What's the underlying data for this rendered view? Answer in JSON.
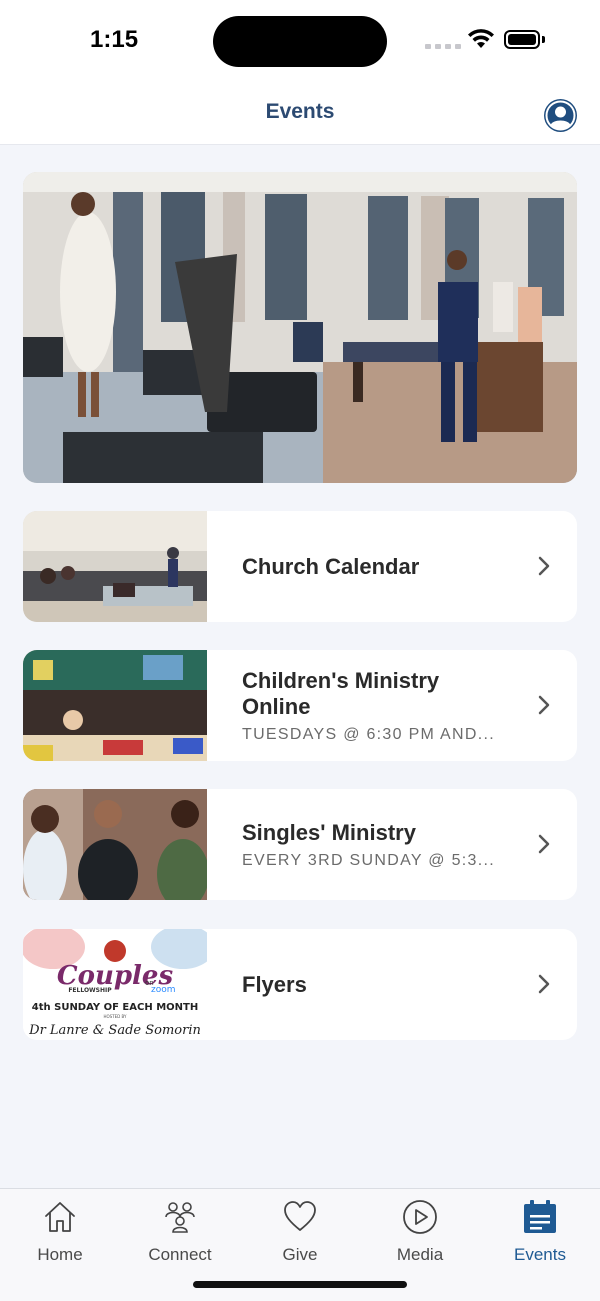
{
  "status_bar": {
    "time": "1:15"
  },
  "header": {
    "title": "Events",
    "profile_icon": "profile-icon"
  },
  "colors": {
    "accent": "#1f5a93",
    "title": "#2c4a72",
    "background": "#f3f5fa"
  },
  "hero": {
    "image": "worship-stage-photo"
  },
  "events": [
    {
      "title": "Church Calendar",
      "subtitle": "",
      "thumbnail": "congregation-photo"
    },
    {
      "title": "Children's Ministry Online",
      "subtitle": "TUESDAYS @ 6:30 PM AND...",
      "thumbnail": "children-classroom-photo"
    },
    {
      "title": "Singles' Ministry",
      "subtitle": "EVERY 3RD SUNDAY @ 5:3...",
      "thumbnail": "singles-group-photo"
    },
    {
      "title": "Flyers",
      "subtitle": "",
      "thumbnail": "couples-flyer",
      "flyer_text": {
        "headline": "Couples",
        "on": "on",
        "zoom": "zoom",
        "fellowship": "FELLOWSHIP",
        "schedule": "4th SUNDAY OF EACH MONTH",
        "hosted_by": "HOSTED BY",
        "hosts": "Dr Lanre & Sade Somorin"
      }
    }
  ],
  "tabbar": {
    "items": [
      {
        "label": "Home",
        "icon": "home-icon",
        "active": false
      },
      {
        "label": "Connect",
        "icon": "people-icon",
        "active": false
      },
      {
        "label": "Give",
        "icon": "heart-icon",
        "active": false
      },
      {
        "label": "Media",
        "icon": "play-icon",
        "active": false
      },
      {
        "label": "Events",
        "icon": "calendar-icon",
        "active": true
      }
    ]
  }
}
